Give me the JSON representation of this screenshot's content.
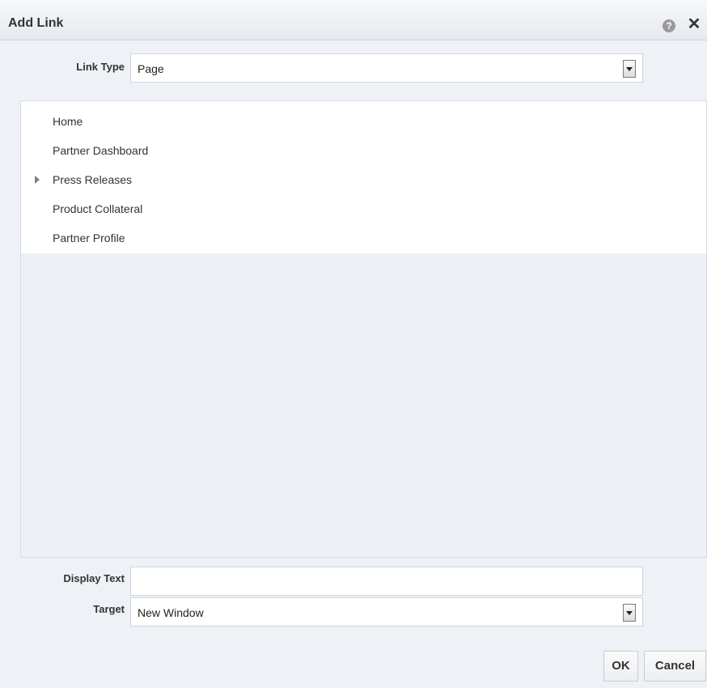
{
  "dialog": {
    "title": "Add Link",
    "help_icon": "question-circle-icon",
    "help_icon_glyph": "?",
    "close_icon": "close-icon",
    "close_icon_glyph": "✕"
  },
  "form": {
    "link_type": {
      "label": "Link Type",
      "value": "Page"
    },
    "display_text": {
      "label": "Display Text",
      "value": ""
    },
    "target": {
      "label": "Target",
      "value": "New Window"
    }
  },
  "tree": {
    "items": [
      {
        "label": "Home",
        "expandable": false
      },
      {
        "label": "Partner Dashboard",
        "expandable": false
      },
      {
        "label": "Press Releases",
        "expandable": true
      },
      {
        "label": "Product Collateral",
        "expandable": false
      },
      {
        "label": "Partner Profile",
        "expandable": false
      }
    ]
  },
  "buttons": {
    "ok": "OK",
    "cancel": "Cancel"
  },
  "colors": {
    "dialog_background": "#eef1f5",
    "tree_background": "#ffffff"
  }
}
